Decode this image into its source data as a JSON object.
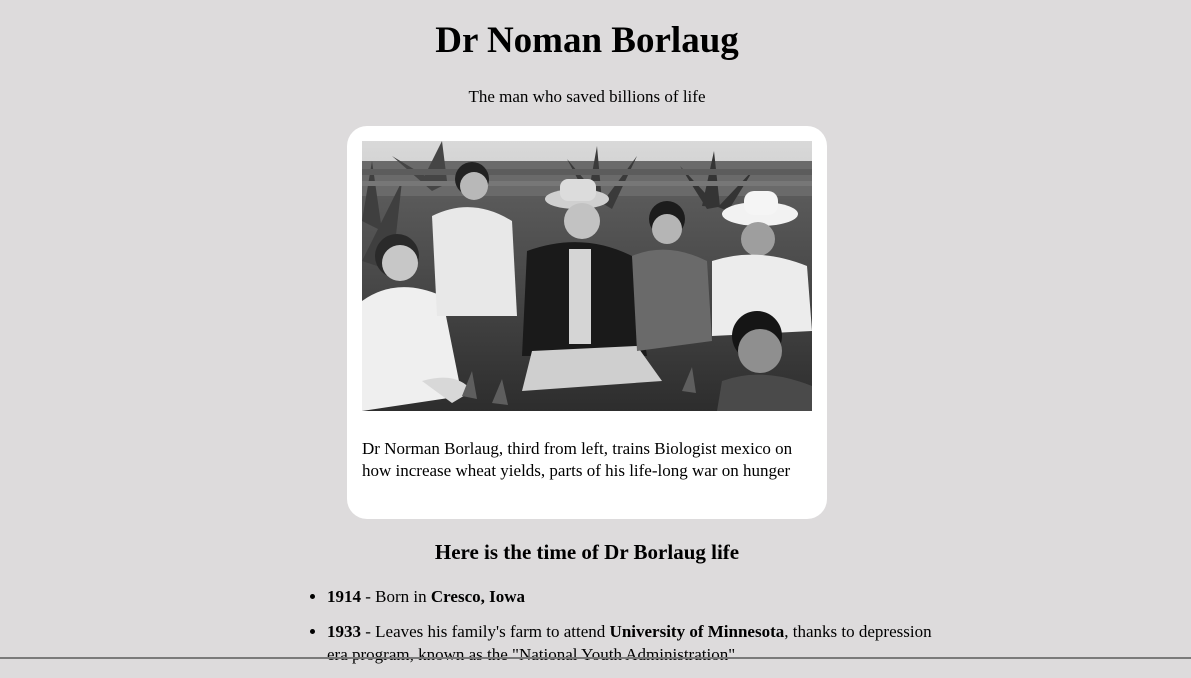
{
  "page": {
    "title": "Dr Noman Borlaug",
    "subtitle": "The man who saved billions of life"
  },
  "figure": {
    "image_icon": "photo-group-in-field",
    "caption": "Dr Norman Borlaug, third from left, trains Biologist mexico on how increase wheat yields, parts of his life-long war on hunger"
  },
  "timeline": {
    "heading": "Here is the time of Dr Borlaug life",
    "items": [
      {
        "year": "1914",
        "text_before": " - Born in ",
        "highlight": "Cresco, Iowa",
        "text_after": ""
      },
      {
        "year": "1933",
        "text_before": " - Leaves his family's farm to attend ",
        "highlight": "University of Minnesota",
        "text_after": ", thanks to depression era program, known as the \"National Youth Administration\""
      }
    ]
  },
  "colors": {
    "background": "#dddbdc",
    "card": "#ffffff",
    "text": "#000000"
  }
}
